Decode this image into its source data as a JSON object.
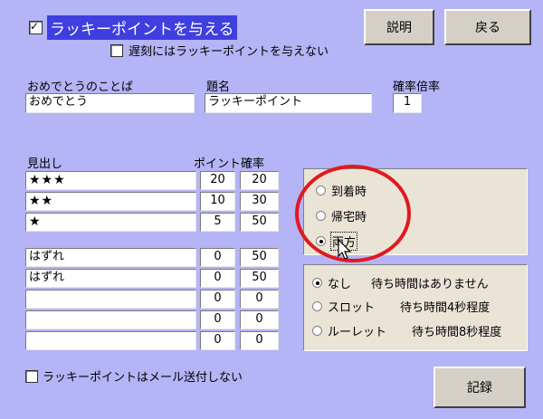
{
  "header": {
    "main_checkbox_label": "ラッキーポイントを与える",
    "late_checkbox_label": "遅刻にはラッキーポイントを与えない",
    "help_button": "説明",
    "back_button": "戻る"
  },
  "fields": {
    "congrats_label": "おめでとうのことば",
    "congrats_value": "おめでとう",
    "title_label": "題名",
    "title_value": "ラッキーポイント",
    "multiplier_label": "確率倍率",
    "multiplier_value": "1"
  },
  "table": {
    "headers": {
      "heading": "見出し",
      "points": "ポイント",
      "probability": "確率"
    },
    "rows": [
      {
        "heading": "★★★",
        "points": "20",
        "probability": "20"
      },
      {
        "heading": "★★",
        "points": "10",
        "probability": "30"
      },
      {
        "heading": "★",
        "points": "5",
        "probability": "50"
      },
      {
        "heading": "はずれ",
        "points": "0",
        "probability": "50"
      },
      {
        "heading": "はずれ",
        "points": "0",
        "probability": "50"
      },
      {
        "heading": "",
        "points": "0",
        "probability": "0"
      },
      {
        "heading": "",
        "points": "0",
        "probability": "0"
      },
      {
        "heading": "",
        "points": "0",
        "probability": "0"
      }
    ]
  },
  "timing_options": {
    "selected": "両方",
    "options": [
      "到着時",
      "帰宅時",
      "両方"
    ]
  },
  "wait_options": {
    "selected": "なし",
    "options": [
      {
        "name": "なし",
        "desc": "待ち時間はありません"
      },
      {
        "name": "スロット",
        "desc": "待ち時間4秒程度"
      },
      {
        "name": "ルーレット",
        "desc": "待ち時間8秒程度"
      }
    ]
  },
  "footer": {
    "mail_checkbox_label": "ラッキーポイントはメール送付しない",
    "record_button": "記録"
  },
  "colors": {
    "background": "#b4b4f6",
    "group_bg": "#e9e4d6",
    "annotation_red": "#e0191e"
  }
}
